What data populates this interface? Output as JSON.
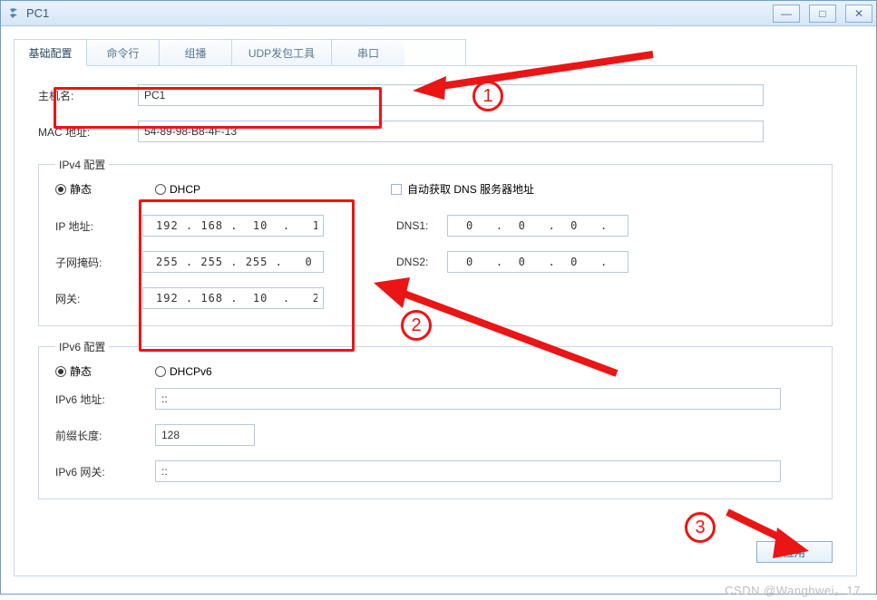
{
  "window": {
    "title": "PC1"
  },
  "tabs": [
    {
      "label": "基础配置",
      "active": true
    },
    {
      "label": "命令行",
      "active": false
    },
    {
      "label": "组播",
      "active": false
    },
    {
      "label": "UDP发包工具",
      "active": false
    },
    {
      "label": "串口",
      "active": false
    }
  ],
  "basic": {
    "hostname_label": "主机名:",
    "hostname_value": "PC1",
    "mac_label": "MAC 地址:",
    "mac_value": "54-89-98-B8-4F-13"
  },
  "ipv4": {
    "legend": "IPv4 配置",
    "radio_static": "静态",
    "radio_dhcp": "DHCP",
    "static_selected": true,
    "auto_dns_label": "自动获取 DNS 服务器地址",
    "ip_label": "IP 地址:",
    "ip_value": "192 . 168 .  10  .   1",
    "mask_label": "子网掩码:",
    "mask_value": "255 . 255 . 255 .   0",
    "gw_label": "网关:",
    "gw_value": "192 . 168 .  10  .   2",
    "dns1_label": "DNS1:",
    "dns1_value": "0   .  0   .  0   .  0",
    "dns2_label": "DNS2:",
    "dns2_value": "0   .  0   .  0   .  0"
  },
  "ipv6": {
    "legend": "IPv6 配置",
    "radio_static": "静态",
    "radio_dhcpv6": "DHCPv6",
    "static_selected": true,
    "addr_label": "IPv6 地址:",
    "addr_value": "::",
    "prefix_label": "前缀长度:",
    "prefix_value": "128",
    "gw_label": "IPv6 网关:",
    "gw_value": "::"
  },
  "buttons": {
    "apply": "应用"
  },
  "annotations": {
    "step1": "1",
    "step2": "2",
    "step3": "3"
  },
  "watermark": "CSDN @Wanghwei。17"
}
